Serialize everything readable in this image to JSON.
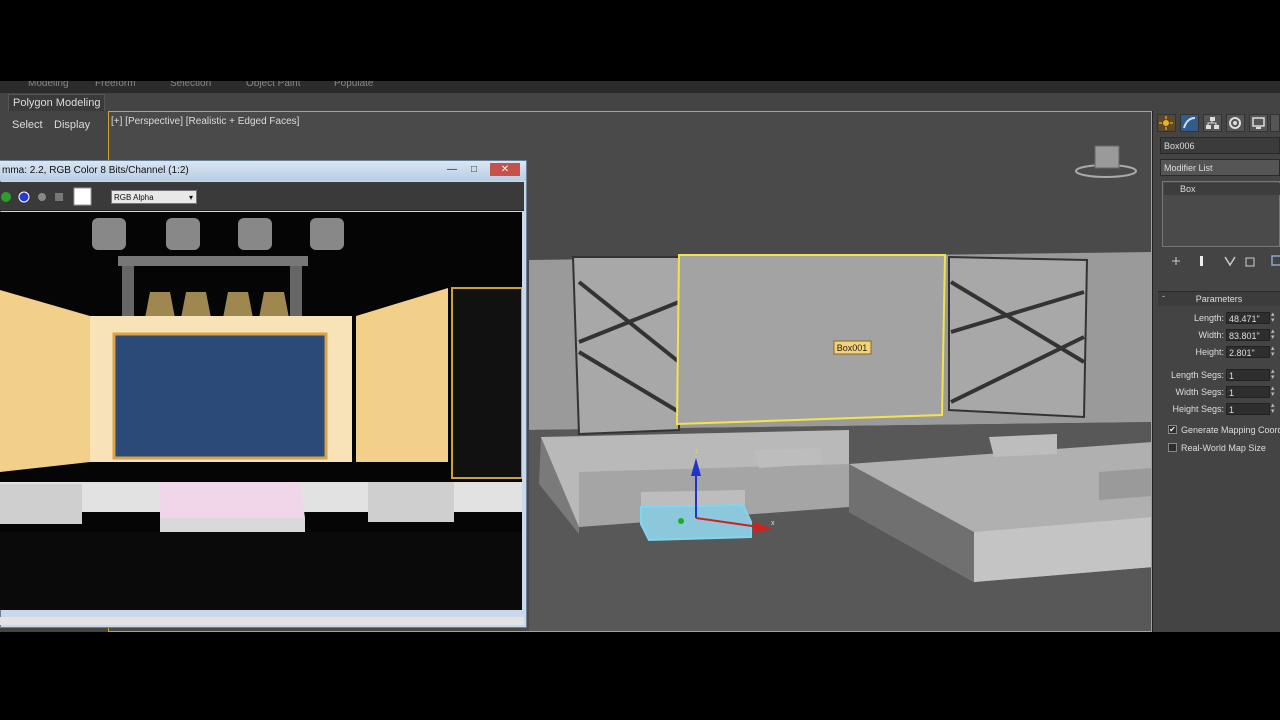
{
  "ribbon": {
    "tabs": [
      "Modeling",
      "Freeform",
      "Selection",
      "Object Paint",
      "Populate"
    ],
    "active_panel": "Polygon Modeling"
  },
  "scene_explorer": {
    "tabs": [
      "Select",
      "Display"
    ]
  },
  "viewport": {
    "label": "[+] [Perspective] [Realistic + Edged Faces]",
    "selected_object_tag": "Box001",
    "gizmo_axes": {
      "x": "x",
      "y": "y",
      "z": "z"
    }
  },
  "render_window": {
    "title": "mma: 2.2, RGB Color 8 Bits/Channel (1:2)",
    "channel": "RGB Alpha",
    "buttons": {
      "minimize": "—",
      "maximize": "□",
      "close": "✕"
    }
  },
  "command_panel": {
    "object_name": "Box006",
    "modifier_list_label": "Modifier List",
    "stack": [
      "Box"
    ],
    "rollout_title": "Parameters",
    "rollout_toggle": "-",
    "params": [
      {
        "label": "Length:",
        "value": "48.471\""
      },
      {
        "label": "Width:",
        "value": "83.801\""
      },
      {
        "label": "Height:",
        "value": "2.801\""
      },
      {
        "label": "Length Segs:",
        "value": "1"
      },
      {
        "label": "Width Segs:",
        "value": "1"
      },
      {
        "label": "Height Segs:",
        "value": "1"
      }
    ],
    "checkboxes": [
      {
        "label": "Generate Mapping Coords.",
        "checked": true,
        "mark": "✔"
      },
      {
        "label": "Real-World Map Size",
        "checked": false,
        "mark": ""
      }
    ]
  },
  "colors": {
    "viewport_border": "#c9a23a",
    "selection_outline": "#f2e54a",
    "selected_box": "#7fd6f0",
    "label_bg": "#f5d27a"
  }
}
